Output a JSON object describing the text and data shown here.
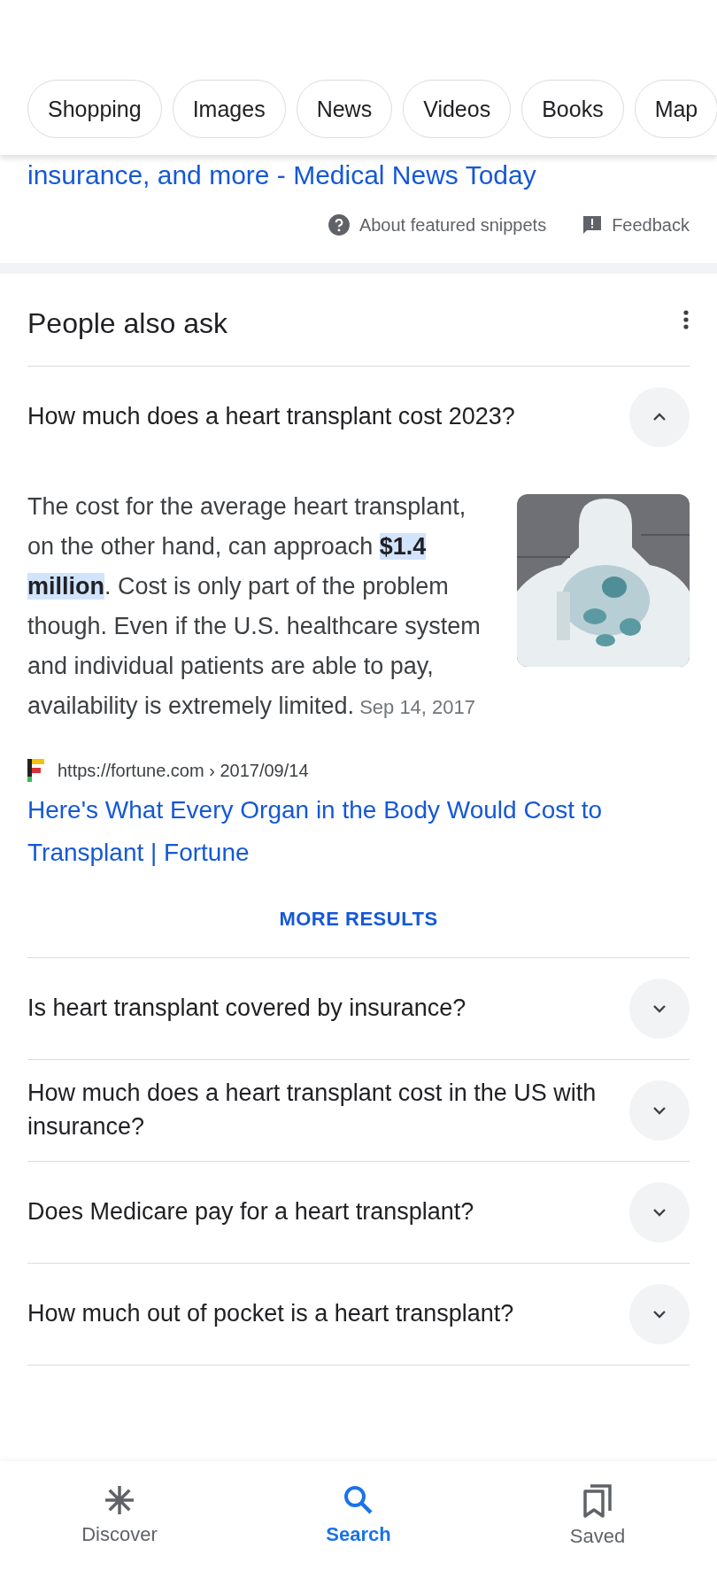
{
  "chips": [
    {
      "label": "Shopping"
    },
    {
      "label": "Images"
    },
    {
      "label": "News"
    },
    {
      "label": "Videos"
    },
    {
      "label": "Books"
    },
    {
      "label": "Map"
    }
  ],
  "previous_result": {
    "title": "insurance, and more - Medical News Today",
    "about": "About featured snippets",
    "feedback": "Feedback"
  },
  "people_also_ask": {
    "title": "People also ask",
    "questions": [
      {
        "text": "How much does a heart transplant cost 2023?",
        "expanded": true,
        "answer": {
          "text": "The cost for the average heart transplant, on the other hand, can approach **$1.4 million**. Cost is only part of the problem though. Even if the U.S. healthcare system and individual patients are able to pay, availability is extremely limited.",
          "date": "Sep 14, 2017",
          "source_url": "https://fortune.com › 2017/09/14",
          "source_title": "Here's What Every Organ in the Body Would Cost to Transplant | Fortune"
        }
      },
      {
        "text": "Is heart transplant covered by insurance?",
        "expanded": false
      },
      {
        "text": "How much does a heart transplant cost in the US with insurance?",
        "expanded": false
      },
      {
        "text": "Does Medicare pay for a heart transplant?",
        "expanded": false
      },
      {
        "text": "How much out of pocket is a heart transplant?",
        "expanded": false
      }
    ],
    "more": "MORE RESULTS"
  },
  "bottom_nav": [
    {
      "label": "Discover",
      "selected": false
    },
    {
      "label": "Search",
      "selected": true
    },
    {
      "label": "Saved",
      "selected": false
    }
  ]
}
